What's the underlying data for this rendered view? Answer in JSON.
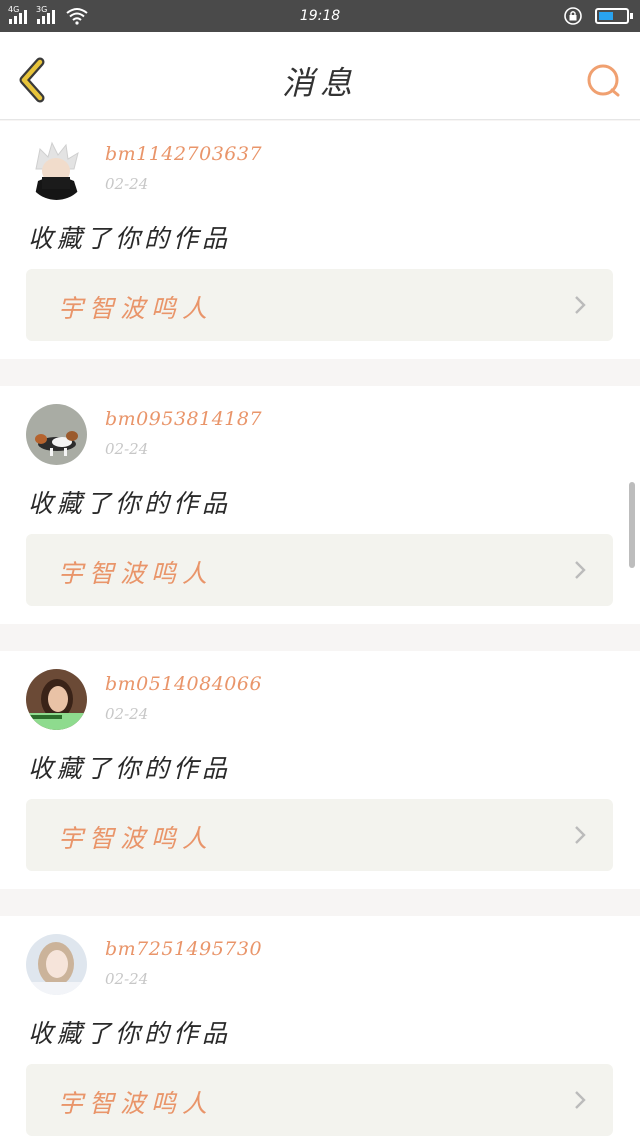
{
  "status_bar": {
    "network_1": "4G",
    "network_2": "3G",
    "time": "19:18",
    "battery_level": 0.55,
    "battery_color": "#29a3f0"
  },
  "header": {
    "title": "消息",
    "back_icon": "chevron-left-icon",
    "search_icon": "search-icon"
  },
  "messages": [
    {
      "username": "bm1142703637",
      "date": "02-24",
      "text": "收藏了你的作品",
      "work_title": "宇智波鸣人",
      "avatar": "white-hair-ninja"
    },
    {
      "username": "bm0953814187",
      "date": "02-24",
      "text": "收藏了你的作品",
      "work_title": "宇智波鸣人",
      "avatar": "dog"
    },
    {
      "username": "bm0514084066",
      "date": "02-24",
      "text": "收藏了你的作品",
      "work_title": "宇智波鸣人",
      "avatar": "woman-portrait"
    },
    {
      "username": "bm7251495730",
      "date": "02-24",
      "text": "收藏了你的作品",
      "work_title": "宇智波鸣人",
      "avatar": "woman-portrait-light"
    }
  ],
  "colors": {
    "accent": "#e9956a",
    "back_icon": "#e8c43a"
  }
}
